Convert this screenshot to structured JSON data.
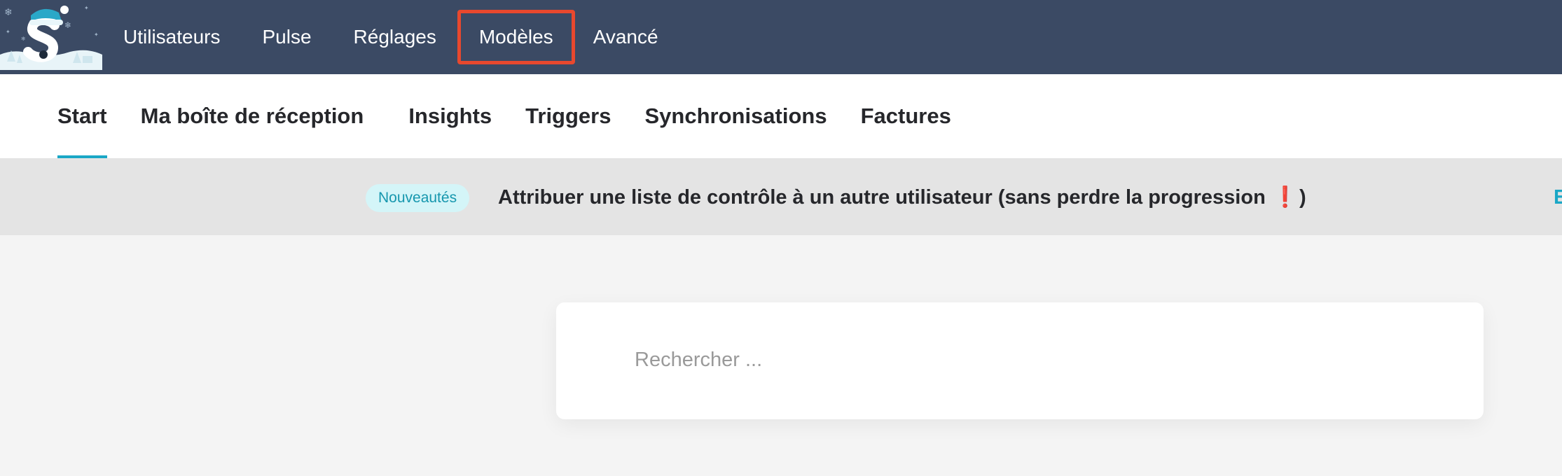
{
  "topnav": {
    "items": [
      {
        "label": "Utilisateurs"
      },
      {
        "label": "Pulse"
      },
      {
        "label": "Réglages"
      },
      {
        "label": "Modèles",
        "highlighted": true
      },
      {
        "label": "Avancé"
      }
    ],
    "background": "#3b4a64",
    "highlight_color": "#e8482e"
  },
  "subtabs": {
    "items": [
      {
        "label": "Start",
        "active": true
      },
      {
        "label": "Ma boîte de réception"
      },
      {
        "label": "Insights"
      },
      {
        "label": "Triggers"
      },
      {
        "label": "Synchronisations"
      },
      {
        "label": "Factures"
      }
    ],
    "active_underline_color": "#1aa7c6"
  },
  "announcement": {
    "badge": "Nouveautés",
    "text": "Attribuer une liste de contrôle à un autre utilisateur (sans perdre la progression",
    "emoji": "❗",
    "text_end": ")",
    "cut_text": "E"
  },
  "search": {
    "placeholder": "Rechercher ..."
  },
  "logo": {
    "icon": "snow-letter-s-logo-icon"
  }
}
